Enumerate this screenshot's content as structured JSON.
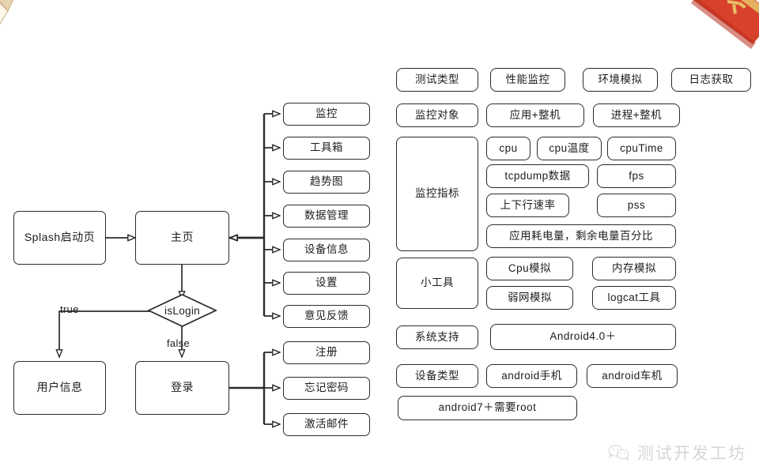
{
  "flow": {
    "splash": "Splash启动页",
    "home": "主页",
    "decision": "isLogin",
    "label_true": "true",
    "label_false": "false",
    "user_info": "用户信息",
    "login": "登录",
    "home_menu": [
      "监控",
      "工具箱",
      "趋势图",
      "数据管理",
      "设备信息",
      "设置",
      "意见反馈"
    ],
    "login_menu": [
      "注册",
      "忘记密码",
      "激活邮件"
    ]
  },
  "spec": {
    "rows": [
      {
        "label": "测试类型",
        "values": [
          "性能监控",
          "环境模拟",
          "日志获取"
        ]
      },
      {
        "label": "监控对象",
        "values": [
          "应用+整机",
          "进程+整机"
        ]
      },
      {
        "label": "监控指标",
        "values": [
          "cpu",
          "cpu温度",
          "cpuTime",
          "tcpdump数据",
          "fps",
          "上下行速率",
          "pss",
          "应用耗电量，剩余电量百分比"
        ]
      },
      {
        "label": "小工具",
        "values": [
          "Cpu模拟",
          "内存模拟",
          "弱网模拟",
          "logcat工具"
        ]
      },
      {
        "label": "系统支持",
        "values": [
          "Android4.0＋"
        ]
      },
      {
        "label": "设备类型",
        "values": [
          "android手机",
          "android车机",
          "android7＋需要root"
        ]
      }
    ]
  },
  "watermark": {
    "text": "测试开发工坊",
    "logo": "wechat-icon"
  },
  "colors": {
    "stroke": "#2b2b2b",
    "fan": "#e3cba4",
    "banner": "#d8412b",
    "banner_gold": "#e8c56a",
    "background": "#ffffff"
  }
}
